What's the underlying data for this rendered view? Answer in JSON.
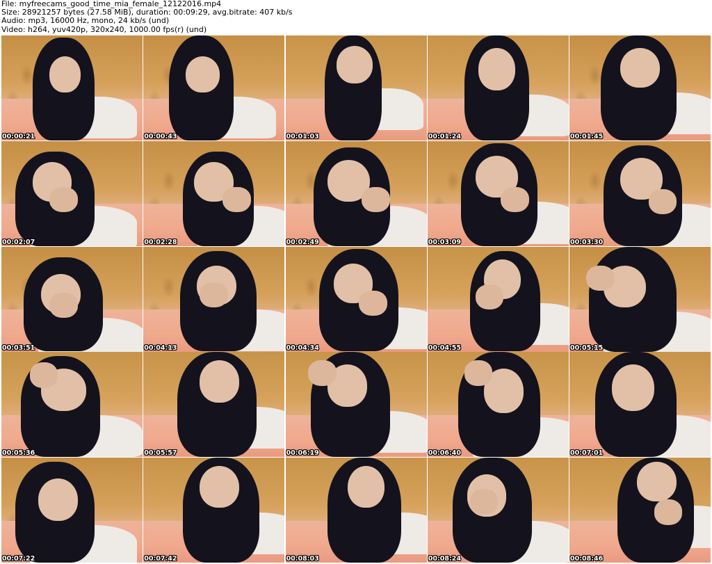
{
  "header": {
    "file": "File: myfreecams_good_time_mia_female_12122016.mp4",
    "size": "Size: 28921257 bytes (27.58 MiB), duration: 00:09:29, avg.bitrate: 407 kb/s",
    "audio": "Audio: mp3, 16000 Hz, mono, 24 kb/s (und)",
    "video": "Video: h264, yuv420p, 320x240, 1000.00 fps(r) (und)"
  },
  "thumbnails": [
    {
      "timestamp": "00:00:21"
    },
    {
      "timestamp": "00:00:43"
    },
    {
      "timestamp": "00:01:03"
    },
    {
      "timestamp": "00:01:24"
    },
    {
      "timestamp": "00:01:45"
    },
    {
      "timestamp": "00:02:07"
    },
    {
      "timestamp": "00:02:28"
    },
    {
      "timestamp": "00:02:49"
    },
    {
      "timestamp": "00:03:09"
    },
    {
      "timestamp": "00:03:30"
    },
    {
      "timestamp": "00:03:51"
    },
    {
      "timestamp": "00:04:13"
    },
    {
      "timestamp": "00:04:34"
    },
    {
      "timestamp": "00:04:55"
    },
    {
      "timestamp": "00:05:15"
    },
    {
      "timestamp": "00:05:36"
    },
    {
      "timestamp": "00:05:57"
    },
    {
      "timestamp": "00:06:19"
    },
    {
      "timestamp": "00:06:40"
    },
    {
      "timestamp": "00:07:01"
    },
    {
      "timestamp": "00:07:22"
    },
    {
      "timestamp": "00:07:42"
    },
    {
      "timestamp": "00:08:03"
    },
    {
      "timestamp": "00:08:24"
    },
    {
      "timestamp": "00:08:46"
    }
  ],
  "colors": {
    "background": "#ffffff",
    "header_text": "#000000",
    "timestamp_text": "#ffffff",
    "timestamp_outline": "#000000"
  }
}
